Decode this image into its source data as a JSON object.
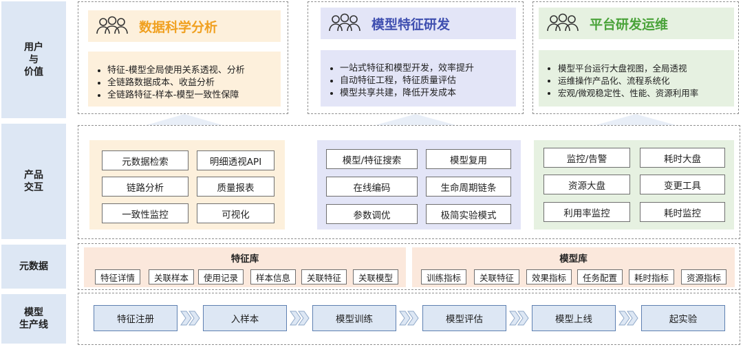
{
  "rows": {
    "users": "用户\n与\n价值",
    "product": "产品\n交互",
    "meta": "元数据",
    "pipeline": "模型\n生产线"
  },
  "value_cards": [
    {
      "title": "数据科学分析",
      "bullets": [
        "特征-模型全局使用关系透视、分析",
        "全链路数据成本、收益分析",
        "全链路特征-样本-模型一致性保障"
      ]
    },
    {
      "title": "模型特征研发",
      "bullets": [
        "一站式特征和模型开发，效率提升",
        "自动特征工程，特征质量评估",
        "模型共享共建，降低开发成本"
      ]
    },
    {
      "title": "平台研发运维",
      "bullets": [
        "模型平台运行大盘视图，全局透视",
        "运维操作产品化、流程系统化",
        "宏观/微观稳定性、性能、资源利用率"
      ]
    }
  ],
  "product_groups": [
    [
      "元数据检索",
      "明细透视API",
      "链路分析",
      "质量报表",
      "一致性监控",
      "可视化"
    ],
    [
      "模型/特征搜索",
      "模型复用",
      "在线编码",
      "生命周期链条",
      "参数调优",
      "极简实验模式"
    ],
    [
      "监控/告警",
      "耗时大盘",
      "资源大盘",
      "变更工具",
      "利用率监控",
      "耗时监控"
    ]
  ],
  "metadata": {
    "feature_lib": {
      "title": "特征库",
      "items": [
        "特征详情",
        "关联样本",
        "使用记录",
        "样本信息",
        "关联特征",
        "关联模型"
      ]
    },
    "model_lib": {
      "title": "模型库",
      "items": [
        "训练指标",
        "关联特征",
        "效果指标",
        "任务配置",
        "耗时指标",
        "资源指标"
      ]
    }
  },
  "pipeline_steps": [
    "特征注册",
    "入样本",
    "模型训练",
    "模型评估",
    "模型上线",
    "起实验"
  ],
  "colors": {
    "row_label_bg": "#dde7f4",
    "orange_bg": "#fdf0dc",
    "orange_title": "#f0a020",
    "purple_bg": "#e3e5f7",
    "purple_title": "#3f4fb0",
    "green_bg": "#e6f1e1",
    "green_title": "#4aa33a"
  }
}
